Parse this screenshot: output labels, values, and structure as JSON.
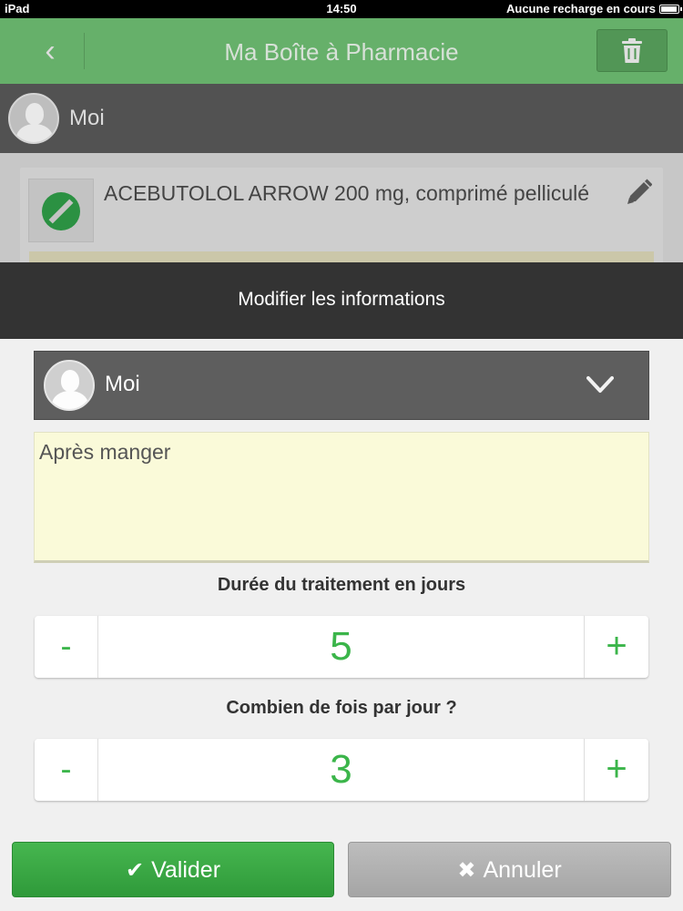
{
  "status_bar": {
    "device": "iPad",
    "time": "14:50",
    "charging": "Aucune recharge en cours"
  },
  "nav": {
    "title": "Ma Boîte à Pharmacie",
    "back_icon": "chevron-left-icon",
    "trash_icon": "trash-icon"
  },
  "profile_bar": {
    "name": "Moi"
  },
  "medication": {
    "name": "ACEBUTOLOL ARROW 200 mg, comprimé pelliculé",
    "edit_icon": "pencil-icon"
  },
  "modal": {
    "title": "Modifier les informations",
    "user_select": {
      "selected": "Moi"
    },
    "note": {
      "value": "Après manger"
    },
    "duration": {
      "label": "Durée du traitement en jours",
      "minus": "-",
      "value": "5",
      "plus": "+"
    },
    "frequency": {
      "label": "Combien de fois par jour ?",
      "minus": "-",
      "value": "3",
      "plus": "+"
    },
    "validate": {
      "glyph": "✔",
      "label": "Valider"
    },
    "cancel": {
      "glyph": "✖",
      "label": "Annuler"
    }
  },
  "colors": {
    "nav_green": "#6fbf73",
    "accent_green": "#3bb54a",
    "modal_header": "#333333",
    "note_bg": "#fafad9"
  }
}
